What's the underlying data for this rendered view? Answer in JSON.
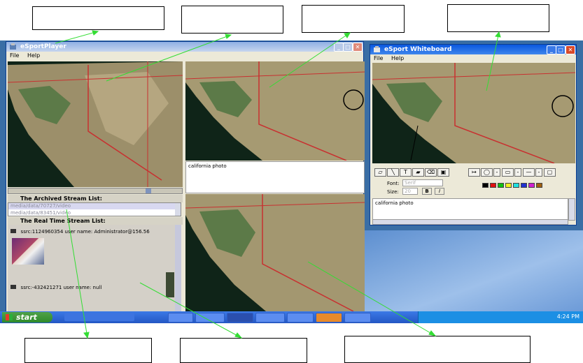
{
  "player": {
    "title": "eSportPlayer",
    "menu": [
      "File",
      "Help"
    ],
    "archived_label": "The Archived Stream List:",
    "archived_items": [
      "media/data/70727/video",
      "media/data/83451/video"
    ],
    "realtime_label": "The Real Time Stream List:",
    "stream1": "ssrc:1124960354   user name: Administrator@156.56",
    "stream2": "ssrc:-432421271   user name: null",
    "caption": "california photo"
  },
  "whiteboard": {
    "title": "eSport Whiteboard",
    "menu": [
      "File",
      "Help"
    ],
    "font_label": "Font:",
    "font_value": "Serif",
    "size_label": "Size:",
    "size_value": "20",
    "bold_label": "B",
    "italic_label": "I",
    "text": "california photo",
    "colors": [
      "#000000",
      "#e01010",
      "#10c010",
      "#f0f020",
      "#20e0e0",
      "#2030d0",
      "#d020d0",
      "#a06010"
    ]
  },
  "taskbar": {
    "start_label": "start",
    "clock": "4:24 PM"
  },
  "icons": [
    "player-app-icon",
    "whiteboard-app-icon",
    "windows-logo-icon",
    "video-icon"
  ]
}
